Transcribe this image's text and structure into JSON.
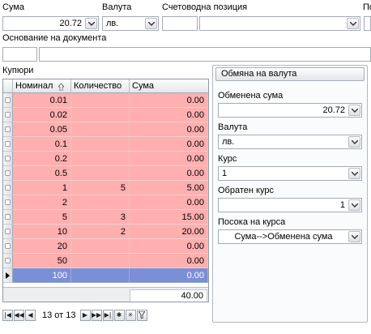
{
  "top": {
    "suma_label": "Сума",
    "suma_value": "20.72",
    "valuta_label": "Валута",
    "valuta_value": "лв.",
    "schet_label": "Счетоводна позиция",
    "po_label": "По",
    "osnovanie_label": "Основание на документа"
  },
  "grid": {
    "title": "Купюри",
    "columns": [
      "Номинал",
      "Количество",
      "Сума"
    ],
    "rows": [
      {
        "nominal": "0.01",
        "kolichestvo": "",
        "suma": "0.00"
      },
      {
        "nominal": "0.02",
        "kolichestvo": "",
        "suma": "0.00"
      },
      {
        "nominal": "0.05",
        "kolichestvo": "",
        "suma": "0.00"
      },
      {
        "nominal": "0.1",
        "kolichestvo": "",
        "suma": "0.00"
      },
      {
        "nominal": "0.2",
        "kolichestvo": "",
        "suma": "0.00"
      },
      {
        "nominal": "0.5",
        "kolichestvo": "",
        "suma": "0.00"
      },
      {
        "nominal": "1",
        "kolichestvo": "5",
        "suma": "5.00"
      },
      {
        "nominal": "2",
        "kolichestvo": "",
        "suma": "0.00"
      },
      {
        "nominal": "5",
        "kolichestvo": "3",
        "suma": "15.00"
      },
      {
        "nominal": "10",
        "kolichestvo": "2",
        "suma": "20.00"
      },
      {
        "nominal": "20",
        "kolichestvo": "",
        "suma": "0.00"
      },
      {
        "nominal": "50",
        "kolichestvo": "",
        "suma": "0.00"
      },
      {
        "nominal": "100",
        "kolichestvo": "",
        "suma": "0.00"
      }
    ],
    "selected_row": 12,
    "total": "40.00",
    "row_color": "#ffafaf",
    "selected_color": "#7a8fd6"
  },
  "navigator": {
    "text": "13 от 13",
    "buttons": [
      "first",
      "prev-page",
      "prev",
      "next",
      "next-page",
      "last",
      "append",
      "delete",
      "filter"
    ]
  },
  "exchange": {
    "title": "Обмяна на валута",
    "obmenena_label": "Обменена сума",
    "obmenena_value": "20.72",
    "valuta_label": "Валута",
    "valuta_value": "лв.",
    "kurs_label": "Курс",
    "kurs_value": "1",
    "obraten_label": "Обратен курс",
    "obraten_value": "1",
    "posoka_label": "Посока на курса",
    "posoka_value": "Сума-->Обменена сума"
  }
}
